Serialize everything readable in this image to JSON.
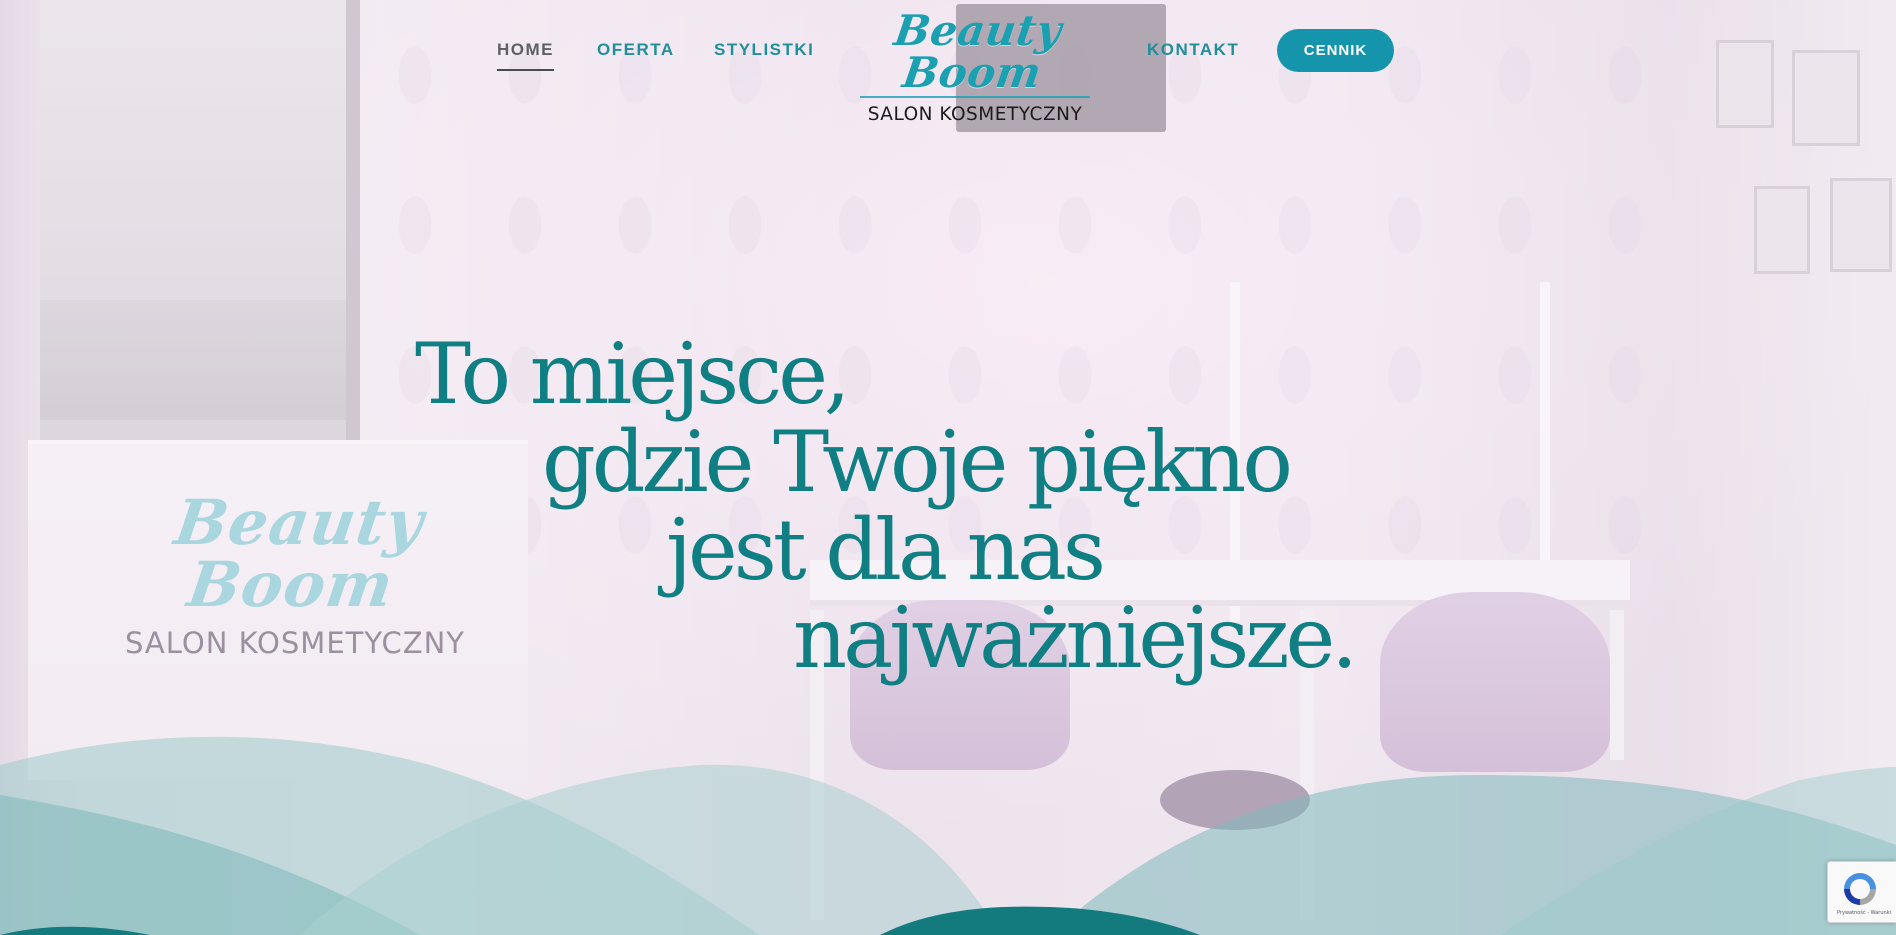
{
  "nav": {
    "items": [
      {
        "label": "HOME"
      },
      {
        "label": "OFERTA"
      },
      {
        "label": "STYLISTKI"
      },
      {
        "label": "KONTAKT"
      }
    ],
    "cta_label": "CENNIK"
  },
  "logo": {
    "script": "Beauty Boom",
    "subtitle": "SALON KOSMETYCZNY"
  },
  "watermark": {
    "script": "Beauty Boom",
    "subtitle": "SALON KOSMETYCZNY"
  },
  "hero": {
    "lines": [
      "To miejsce,",
      "gdzie Twoje piękno",
      "jest dla nas",
      "najważniejsze."
    ]
  },
  "recaptcha": {
    "links": "Prywatność - Warunki"
  },
  "colors": {
    "accent": "#1595ac",
    "hero_text": "#0f7f83",
    "nav_text": "#1f8f99",
    "wave_dark": "#137a7e",
    "wave_light": "#9ccac9"
  }
}
